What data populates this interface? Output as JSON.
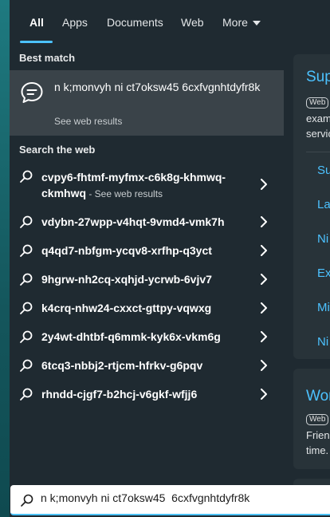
{
  "tabs": [
    {
      "label": "All"
    },
    {
      "label": "Apps"
    },
    {
      "label": "Documents"
    },
    {
      "label": "Web"
    },
    {
      "label": "More"
    }
  ],
  "best_match": {
    "section_title": "Best match",
    "title": "n k;monvyh ni ct7oksw45 6cxfvgnhtdyfr8k",
    "subtitle": "See web results",
    "icon": "chat-bubble-icon"
  },
  "search_web": {
    "section_title": "Search the web",
    "see_label": " - See web results",
    "items": [
      {
        "text": "cvpy6-fhtmf-myfmx-c6k8g-khmwq-ckmhwq"
      },
      {
        "text": "vdybn-27wpp-v4hqt-9vmd4-vmk7h"
      },
      {
        "text": "q4qd7-nbfgm-ycqv8-xrfhp-q3yct"
      },
      {
        "text": "9hgrw-nh2cq-xqhjd-ycrwb-6vjv7"
      },
      {
        "text": "k4crq-nhw24-cxxct-gttpy-vqwxg"
      },
      {
        "text": "2y4wt-dhtbf-q6mmk-kyk6x-vkm6g"
      },
      {
        "text": "6tcq3-nbbj2-rtjcm-hfrkv-g6pqv"
      },
      {
        "text": "rhndd-cjgf7-b2hcj-v6gkf-wfjj6"
      }
    ]
  },
  "right_panel": {
    "card1": {
      "title": "Sup",
      "badge": "Web",
      "lines": [
        "exam",
        "servic"
      ],
      "links": [
        "Su",
        "La",
        "Ni",
        "Ex",
        "Mi",
        "Ni"
      ]
    },
    "card2": {
      "title": "Wor",
      "badge": "Web",
      "lines": [
        "Frien",
        "time."
      ]
    }
  },
  "search": {
    "value": "n k;monvyh ni ct7oksw45  6cxfvgnhtdyfr8k"
  },
  "colors": {
    "accent": "#4cc2ff",
    "panel": "#1f2a31",
    "selected": "#3a4349"
  }
}
